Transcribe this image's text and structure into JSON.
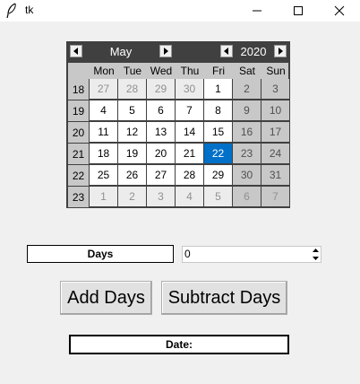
{
  "window": {
    "title": "tk",
    "icon": "feather-icon",
    "controls": [
      "minimize-icon",
      "maximize-icon",
      "close-icon"
    ]
  },
  "calendar": {
    "month": "May",
    "year": "2020",
    "weekdays": [
      "Mon",
      "Tue",
      "Wed",
      "Thu",
      "Fri",
      "Sat",
      "Sun"
    ],
    "weeks": [
      {
        "num": "18",
        "days": [
          "27",
          "28",
          "29",
          "30",
          "1",
          "2",
          "3"
        ]
      },
      {
        "num": "19",
        "days": [
          "4",
          "5",
          "6",
          "7",
          "8",
          "9",
          "10"
        ]
      },
      {
        "num": "20",
        "days": [
          "11",
          "12",
          "13",
          "14",
          "15",
          "16",
          "17"
        ]
      },
      {
        "num": "21",
        "days": [
          "18",
          "19",
          "20",
          "21",
          "22",
          "23",
          "24"
        ]
      },
      {
        "num": "22",
        "days": [
          "25",
          "26",
          "27",
          "28",
          "29",
          "30",
          "31"
        ]
      },
      {
        "num": "23",
        "days": [
          "1",
          "2",
          "3",
          "4",
          "5",
          "6",
          "7"
        ]
      }
    ],
    "selected_day": "22",
    "colors": {
      "header_bg": "#404040",
      "selected_bg": "#0070c8",
      "weekend_bg": "#c8c8c8",
      "other_month_fg": "#909090"
    }
  },
  "days_label": "Days",
  "days_spinbox": {
    "value": "0"
  },
  "buttons": {
    "add": "Add Days",
    "subtract": "Subtract Days"
  },
  "date_label": "Date:"
}
